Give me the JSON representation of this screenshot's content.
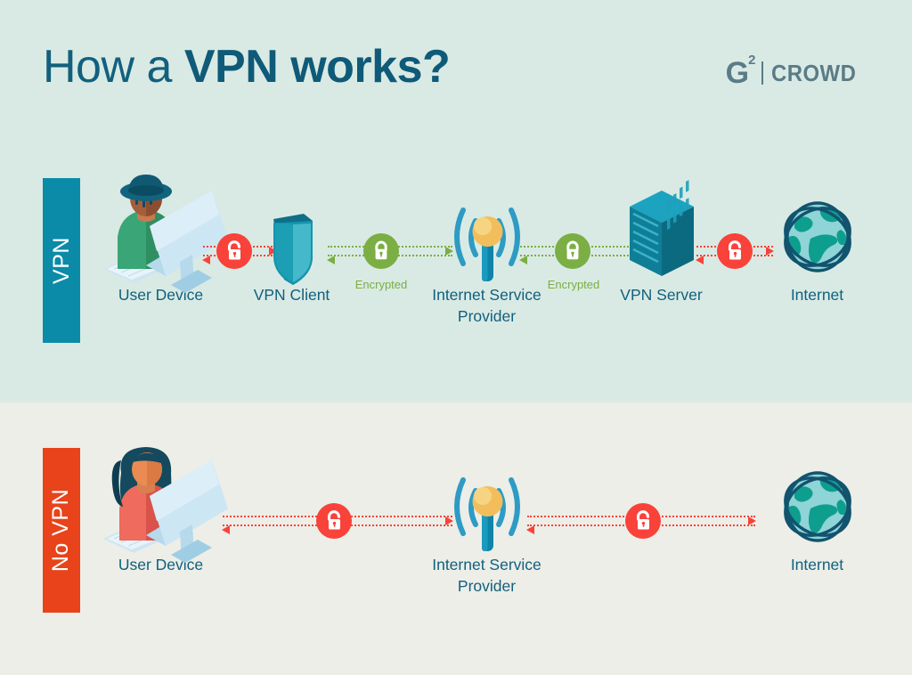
{
  "header": {
    "title_light": "How a ",
    "title_bold": "VPN works?",
    "logo": {
      "g": "G",
      "superscript": "2",
      "word": "CROWD"
    }
  },
  "colors": {
    "band_top": "#D9EAE4",
    "band_bottom": "#ECEEE7",
    "title": "#12607E",
    "ribbon_vpn": "#0B8BA8",
    "ribbon_novpn": "#E8431A",
    "unencrypted_red": "#F9423A",
    "encrypted_green": "#7BAE43",
    "label_text": "#12607E",
    "logo_gray": "#5A7B88"
  },
  "rows": [
    {
      "id": "vpn-row",
      "ribbon_label": "VPN",
      "nodes": [
        {
          "id": "user-device",
          "label": "User Device",
          "icon": "person-at-computer-hat-icon"
        },
        {
          "id": "vpn-client",
          "label": "VPN Client",
          "icon": "shield-icon"
        },
        {
          "id": "isp",
          "label": "Internet Service\nProvider",
          "icon": "antenna-tower-icon"
        },
        {
          "id": "vpn-server",
          "label": "VPN Server",
          "icon": "server-rack-icon"
        },
        {
          "id": "internet",
          "label": "Internet",
          "icon": "globe-icon"
        }
      ],
      "connectors": [
        {
          "id": "conn-user-client",
          "state": "unencrypted",
          "badge": "open-lock-icon",
          "badge_color": "#F9423A",
          "note": ""
        },
        {
          "id": "conn-client-isp",
          "state": "encrypted",
          "badge": "closed-lock-icon",
          "badge_color": "#7BAE43",
          "note": "Encrypted"
        },
        {
          "id": "conn-isp-server",
          "state": "encrypted",
          "badge": "closed-lock-icon",
          "badge_color": "#7BAE43",
          "note": "Encrypted"
        },
        {
          "id": "conn-server-net",
          "state": "unencrypted",
          "badge": "open-lock-icon",
          "badge_color": "#F9423A",
          "note": ""
        }
      ]
    },
    {
      "id": "no-vpn-row",
      "ribbon_label": "No VPN",
      "nodes": [
        {
          "id": "user-device-2",
          "label": "User Device",
          "icon": "person-at-computer-icon"
        },
        {
          "id": "isp-2",
          "label": "Internet Service\nProvider",
          "icon": "antenna-tower-icon"
        },
        {
          "id": "internet-2",
          "label": "Internet",
          "icon": "globe-icon"
        }
      ],
      "connectors": [
        {
          "id": "conn-user-isp-2",
          "state": "unencrypted",
          "badge": "open-lock-icon",
          "badge_color": "#F9423A",
          "note": ""
        },
        {
          "id": "conn-isp-net-2",
          "state": "unencrypted",
          "badge": "open-lock-icon",
          "badge_color": "#F9423A",
          "note": ""
        }
      ]
    }
  ]
}
